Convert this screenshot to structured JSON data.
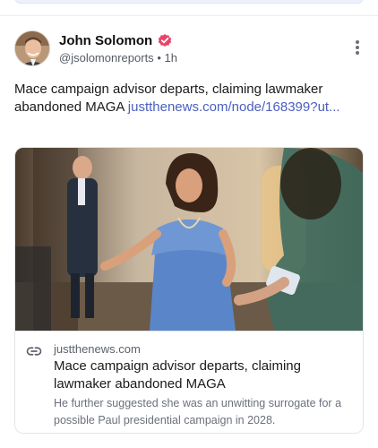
{
  "post": {
    "author_name": "John Solomon",
    "handle": "@jsolomonreports",
    "separator": "•",
    "time": "1h",
    "text": "Mace campaign advisor departs, claiming lawmaker abandoned MAGA ",
    "link_text": "justthenews.com/node/168399?ut...",
    "verified_badge_color": "#e8436a",
    "link_color": "#4a5fc1"
  },
  "card": {
    "domain": "justthenews.com",
    "title": "Mace campaign advisor departs, claiming lawmaker abandoned MAGA",
    "description": "He further suggested she was an unwitting surrogate for a possible Paul presidential campaign in 2028."
  },
  "icons": {
    "verified": "verified-badge-icon",
    "more": "more-options-icon",
    "link": "link-icon"
  }
}
